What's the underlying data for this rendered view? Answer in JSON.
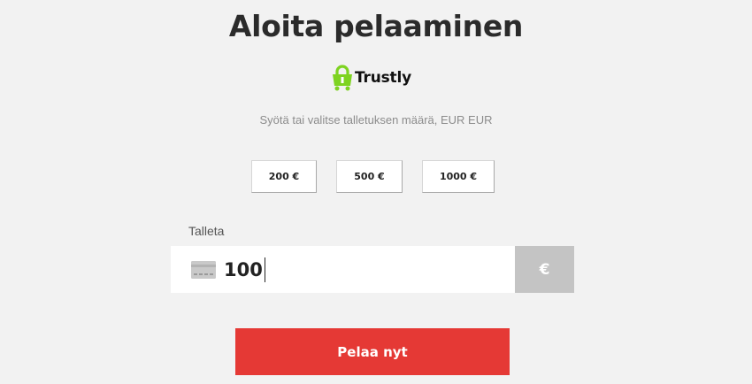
{
  "title": "Aloita pelaaminen",
  "brand": {
    "name": "Trustly",
    "icon": "padlock-icon",
    "color": "#7ed321"
  },
  "subtitle": "Syötä tai valitse talletuksen määrä, EUR EUR",
  "quick_amounts": [
    {
      "label": "200 €"
    },
    {
      "label": "500 €"
    },
    {
      "label": "1000 €"
    }
  ],
  "deposit": {
    "label": "Talleta",
    "value": "100",
    "icon": "credit-card-icon",
    "currency_symbol": "€"
  },
  "cta": {
    "label": "Pelaa nyt",
    "color": "#e53935"
  }
}
